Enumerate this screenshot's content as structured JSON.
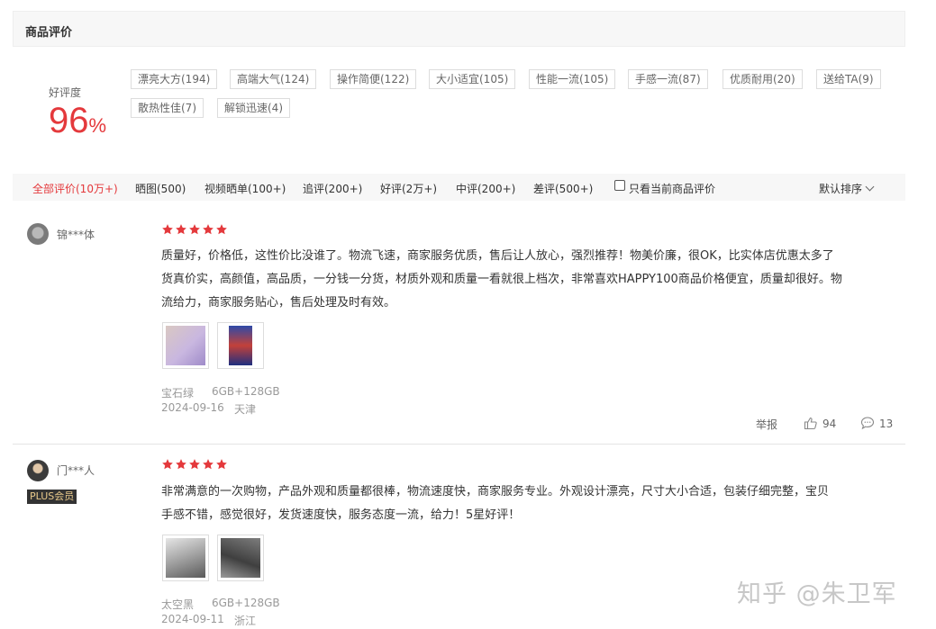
{
  "section": {
    "title": "商品评价"
  },
  "rating": {
    "label": "好评度",
    "value": "96",
    "unit": "%"
  },
  "tags": [
    "漂亮大方(194)",
    "高端大气(124)",
    "操作简便(122)",
    "大小适宜(105)",
    "性能一流(105)",
    "手感一流(87)",
    "优质耐用(20)",
    "送给TA(9)",
    "散热性佳(7)",
    "解锁迅速(4)"
  ],
  "filters": {
    "all": "全部评价(10万+)",
    "pics": "晒图(500)",
    "video": "视频晒单(100+)",
    "followup": "追评(200+)",
    "good": "好评(2万+)",
    "medium": "中评(200+)",
    "bad": "差评(500+)",
    "current_only": "只看当前商品评价",
    "sort": "默认排序"
  },
  "colors": {
    "accent": "#e4393c",
    "star": "#e4393c"
  },
  "reviews": [
    {
      "user": "锦***体",
      "stars": 5,
      "text_line1": "质量好，价格低，这性价比没谁了。物流飞速，商家服务优质，售后让人放心，强烈推荐！物美价廉，很OK，比实体店优惠太多了",
      "text_line2": "货真价实，高颜值，高品质，一分钱一分货，材质外观和质量一看就很上档次，非常喜欢HAPPY100商品价格便宜，质量却很好。物",
      "text_line3": "流给力，商家服务贴心，售后处理及时有效。",
      "color_option": "宝石绿",
      "spec_option": "6GB+128GB",
      "date": "2024-09-16",
      "location": "天津",
      "report": "举报",
      "likes": "94",
      "comments": "13"
    },
    {
      "user": "门***人",
      "badge": "PLUS会员",
      "stars": 5,
      "text_line1": "非常满意的一次购物，产品外观和质量都很棒，物流速度快，商家服务专业。外观设计漂亮，尺寸大小合适，包装仔细完整，宝贝",
      "text_line2": "手感不错，感觉很好，发货速度快，服务态度一流，给力！5星好评！",
      "color_option": "太空黑",
      "spec_option": "6GB+128GB",
      "date": "2024-09-11",
      "location": "浙江"
    }
  ],
  "watermark": "知乎 @朱卫军"
}
